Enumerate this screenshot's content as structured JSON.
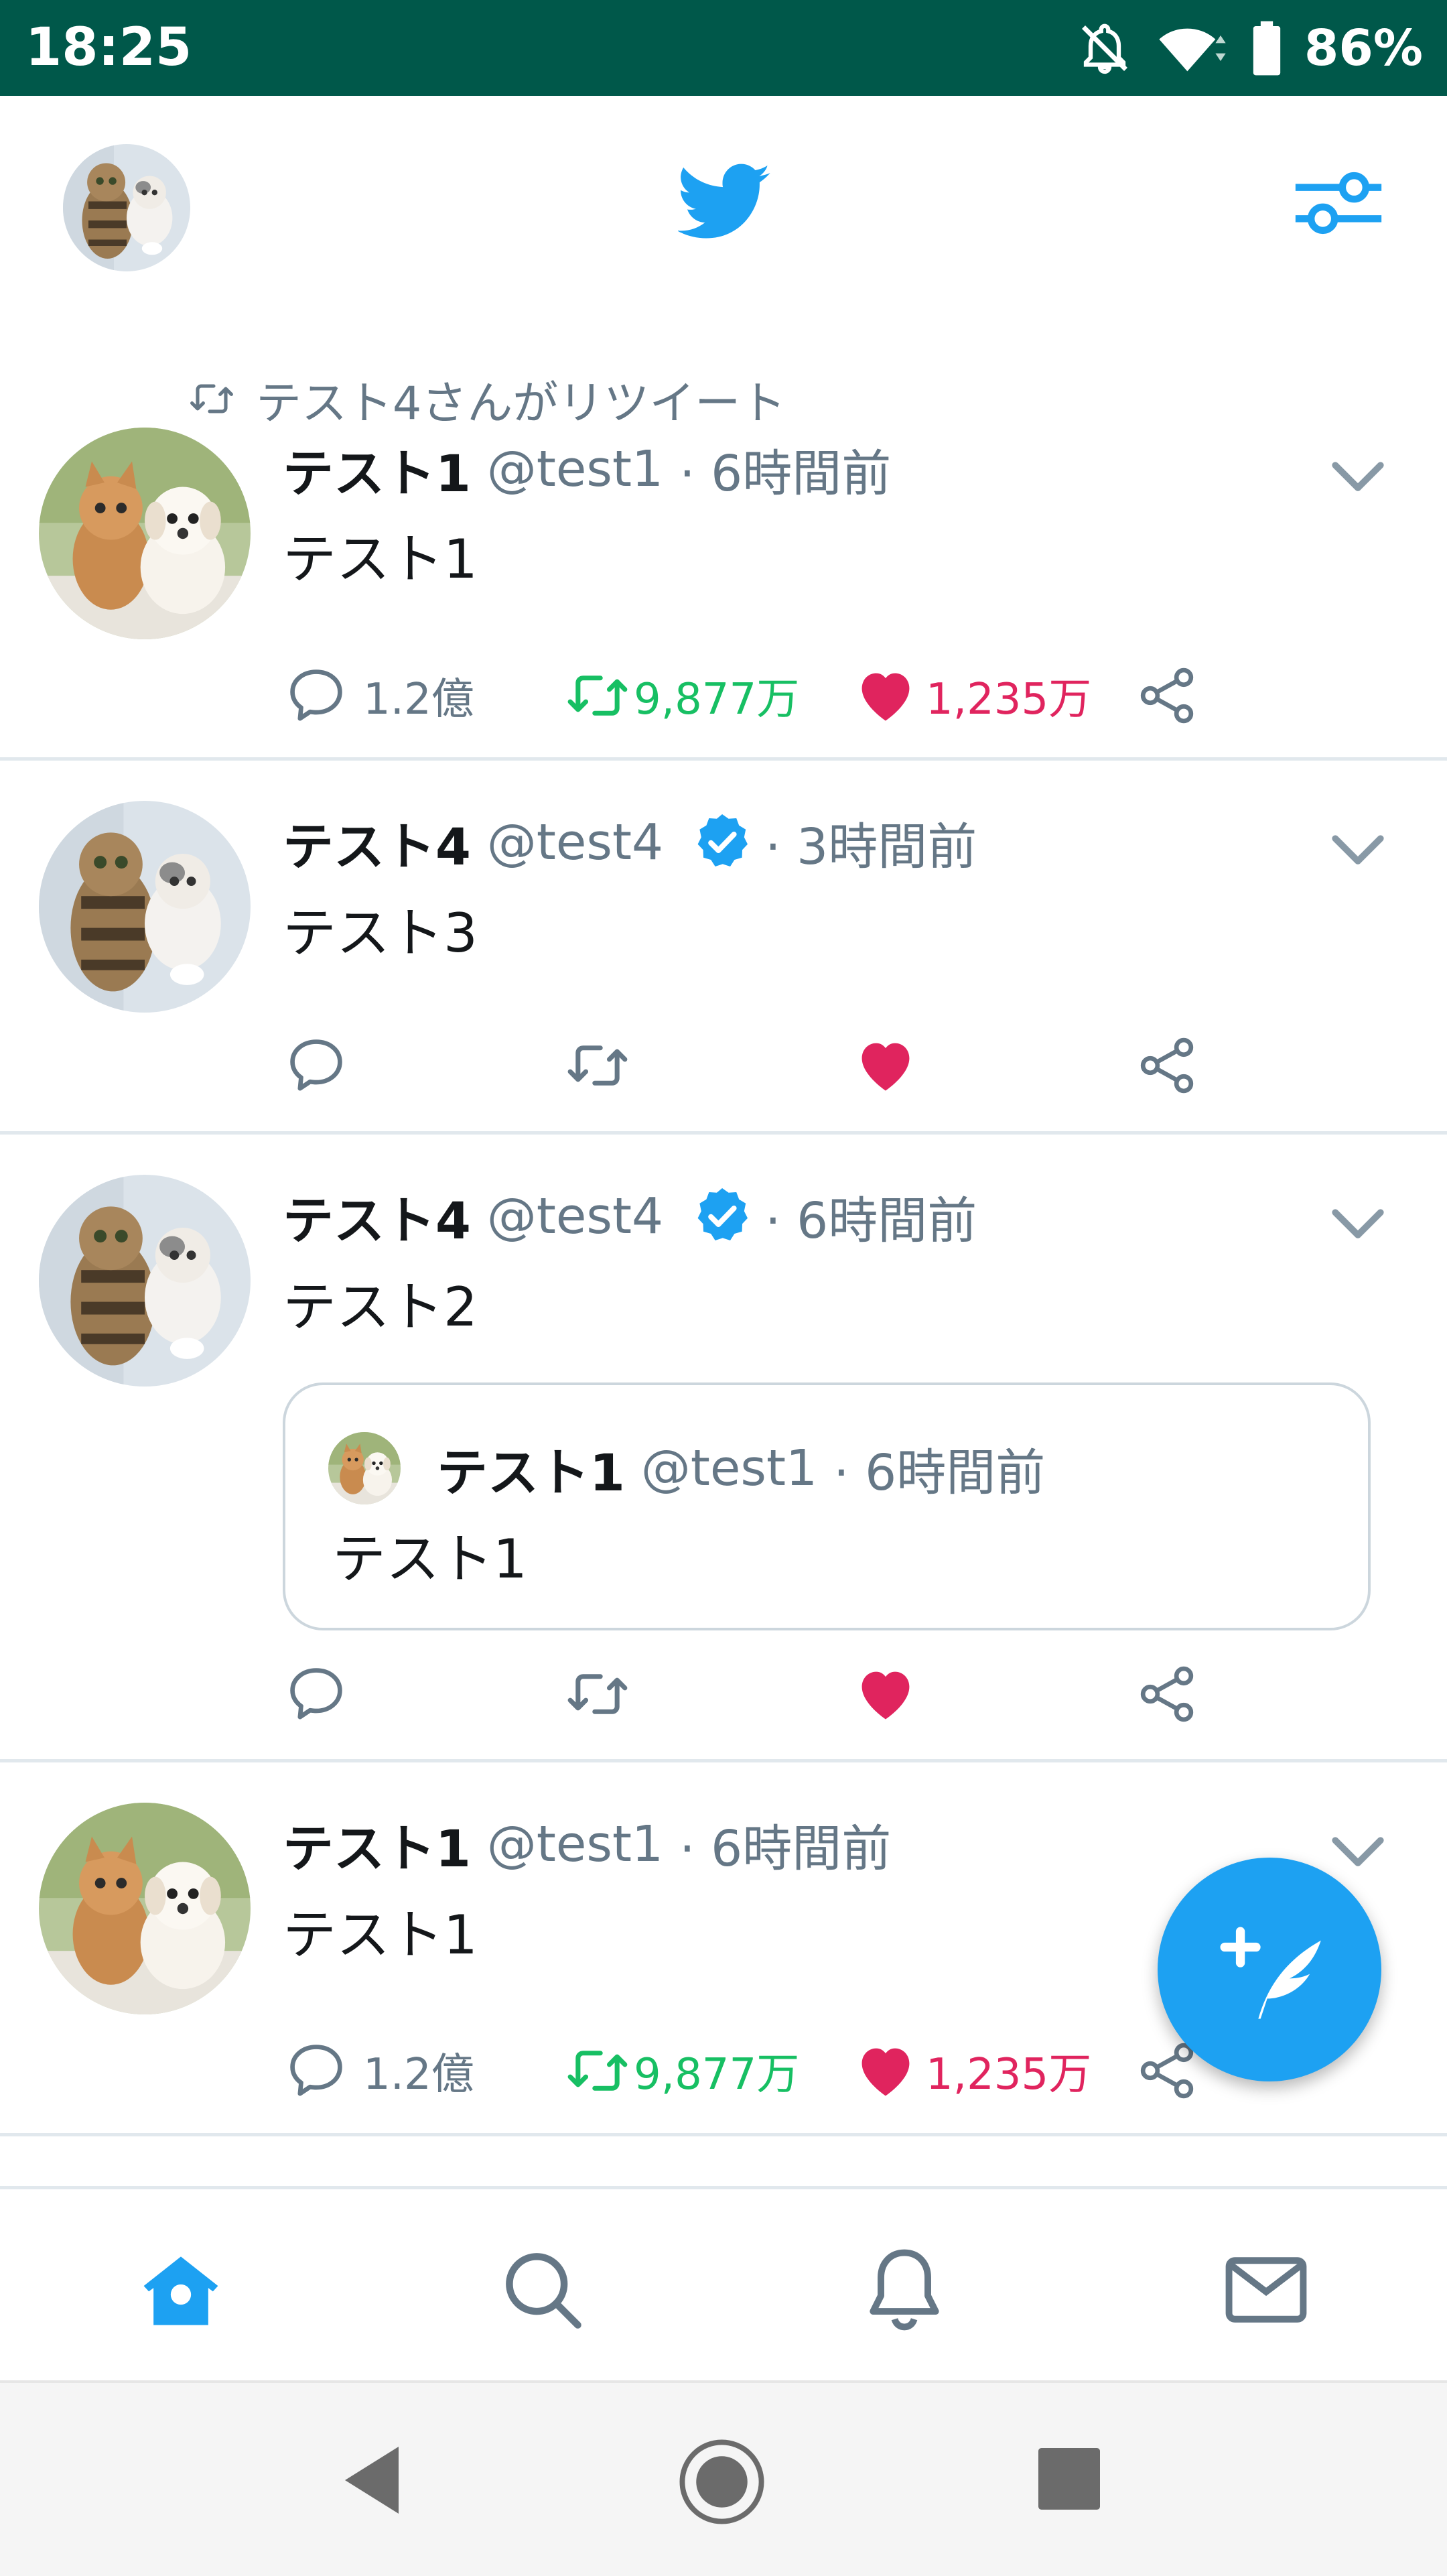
{
  "status_bar": {
    "time": "18:25",
    "battery": "86%"
  },
  "header": {
    "logo_icon": "twitter-bird-icon",
    "filter_icon": "timeline-filter-icon"
  },
  "colors": {
    "accent": "#1da1f2",
    "retweet": "#17bf63",
    "like": "#e0245e",
    "muted": "#657786",
    "statusbar": "#00584a"
  },
  "tweets": [
    {
      "retweeted_by": "テスト4さんがリツイート",
      "name": "テスト1",
      "handle": "@test1",
      "time": "· 6時間前",
      "text": "テスト1",
      "replies": "1.2億",
      "retweets": "9,877万",
      "likes": "1,235万"
    },
    {
      "name": "テスト4",
      "handle": "@test4",
      "verified": true,
      "time": "· 3時間前",
      "text": "テスト3"
    },
    {
      "name": "テスト4",
      "handle": "@test4",
      "verified": true,
      "time": "· 6時間前",
      "text": "テスト2",
      "quote": {
        "name": "テスト1",
        "handle": "@test1",
        "time": "· 6時間前",
        "text": "テスト1"
      }
    },
    {
      "name": "テスト1",
      "handle": "@test1",
      "time": "· 6時間前",
      "text": "テスト1",
      "replies": "1.2億",
      "retweets": "9,877万",
      "likes": "1,235万"
    }
  ],
  "nav": [
    "home-icon",
    "search-icon",
    "bell-icon",
    "mail-icon"
  ]
}
